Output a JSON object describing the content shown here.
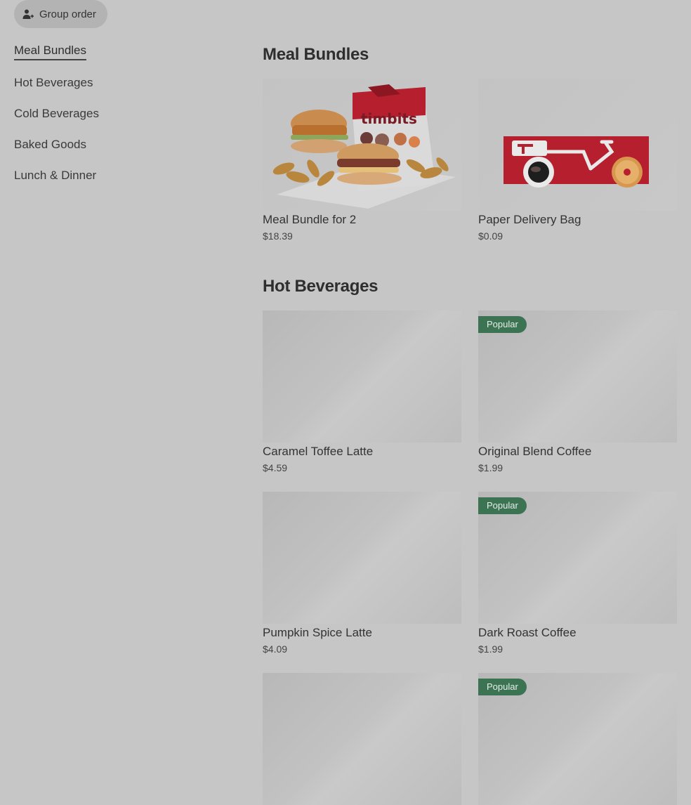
{
  "group_order": {
    "label": "Group order",
    "icon": "person-add-icon"
  },
  "sidebar": {
    "items": [
      {
        "label": "Meal Bundles",
        "active": true
      },
      {
        "label": "Hot Beverages",
        "active": false
      },
      {
        "label": "Cold Beverages",
        "active": false
      },
      {
        "label": "Baked Goods",
        "active": false
      },
      {
        "label": "Lunch & Dinner",
        "active": false
      }
    ]
  },
  "sections": [
    {
      "title": "Meal Bundles",
      "items": [
        {
          "name": "Meal Bundle for 2",
          "price": "$18.39",
          "badge": "",
          "image": "meal-bundle-photo"
        },
        {
          "name": "Paper Delivery Bag",
          "price": "$0.09",
          "badge": "",
          "image": "delivery-bag-photo"
        }
      ]
    },
    {
      "title": "Hot Beverages",
      "items": [
        {
          "name": "Caramel Toffee Latte",
          "price": "$4.59",
          "badge": ""
        },
        {
          "name": "Original Blend Coffee",
          "price": "$1.99",
          "badge": "Popular"
        },
        {
          "name": "Pumpkin Spice Latte",
          "price": "$4.09",
          "badge": ""
        },
        {
          "name": "Dark Roast Coffee",
          "price": "$1.99",
          "badge": "Popular"
        },
        {
          "name": "",
          "price": "",
          "badge": ""
        },
        {
          "name": "",
          "price": "",
          "badge": "Popular"
        }
      ]
    }
  ],
  "colors": {
    "background": "#c6c6c6",
    "badge": "#3b7353",
    "brand_red": "#b51f2e"
  }
}
